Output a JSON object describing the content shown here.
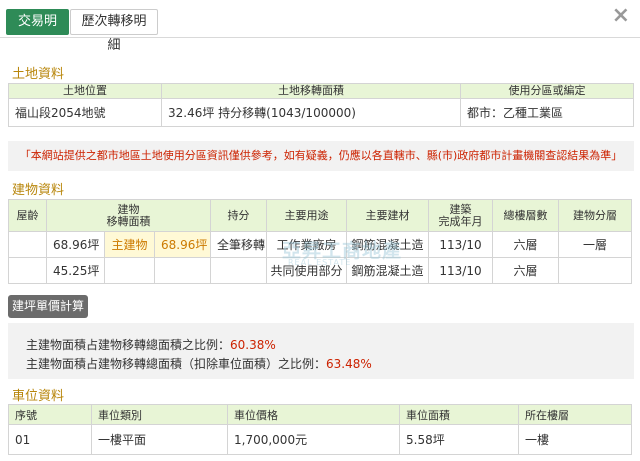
{
  "tabs": [
    {
      "label": "交易明細"
    },
    {
      "label": "歷次轉移明細"
    }
  ],
  "close_label": "×",
  "land": {
    "title": "土地資料",
    "headers": [
      "土地位置",
      "土地移轉面積",
      "使用分區或編定"
    ],
    "row": {
      "location": "福山段2054地號",
      "area": "32.46坪 持分移轉(1043/100000)",
      "zoning": "都市：乙種工業區"
    }
  },
  "notice": "「本網站提供之都市地區土地使用分區資訊僅供參考，如有疑義，仍應以各直轄市、縣(市)政府都市計畫機關查認結果為準」",
  "building": {
    "title": "建物資料",
    "headers": {
      "age": "屋齡",
      "transfer_area": "建物\n移轉面積",
      "share": "持分",
      "main_use": "主要用途",
      "material": "主要建材",
      "completion": "建築\n完成年月",
      "total_floors": "總樓層數",
      "floor": "建物分層"
    },
    "rows": [
      {
        "age": "",
        "area": "68.96坪",
        "main_label": "主建物",
        "main_value": "68.96坪",
        "share": "全筆移轉",
        "use": "工作業廠房",
        "material": "鋼筋混凝土造",
        "completion": "113/10",
        "total_floors": "六層",
        "floor": "一層"
      },
      {
        "age": "",
        "area": "45.25坪",
        "main_label": "",
        "main_value": "",
        "share": "",
        "use": "共同使用部分",
        "material": "鋼筋混凝土造",
        "completion": "113/10",
        "total_floors": "六層",
        "floor": ""
      }
    ]
  },
  "watermark": {
    "main": "亞昇工商地產",
    "sub": "REAL ESTATE"
  },
  "calc_button": "建坪單價計算",
  "ratios": [
    {
      "label": "主建物面積占建物移轉總面積之比例：",
      "value": "60.38%"
    },
    {
      "label": "主建物面積占建物移轉總面積（扣除車位面積）之比例：",
      "value": "63.48%"
    }
  ],
  "parking": {
    "title": "車位資料",
    "headers": [
      "序號",
      "車位類別",
      "車位價格",
      "車位面積",
      "所在樓層"
    ],
    "row": {
      "no": "01",
      "type": "一樓平面",
      "price": "1,700,000元",
      "area": "5.58坪",
      "floor": "一樓"
    }
  }
}
